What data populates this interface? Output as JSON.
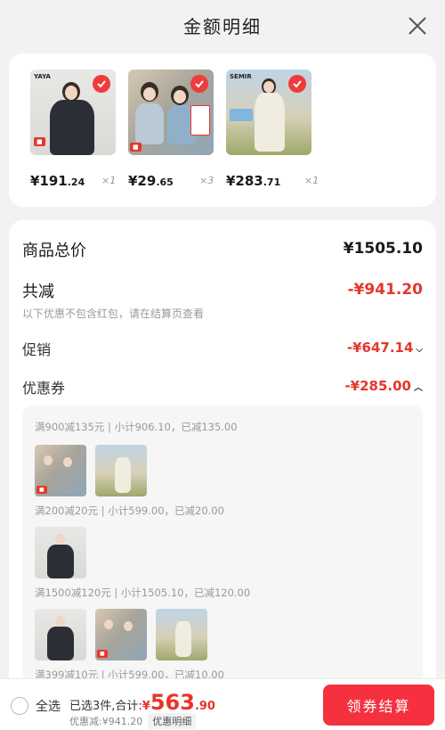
{
  "header": {
    "title": "金额明细"
  },
  "products": [
    {
      "brand": "YAYA",
      "price_int": "¥191",
      "price_dec": ".24",
      "qty": "×1"
    },
    {
      "price_int": "¥29",
      "price_dec": ".65",
      "qty": "×3"
    },
    {
      "brand": "SEMIR",
      "price_int": "¥283",
      "price_dec": ".71",
      "qty": "×1"
    }
  ],
  "summary": {
    "subtotal_label": "商品总价",
    "subtotal_value": "¥1505.10",
    "discount_label": "共减",
    "discount_value": "-¥941.20",
    "note": "以下优惠不包含红包，请在结算页查看",
    "promo_label": "促销",
    "promo_value": "-¥647.14",
    "coupon_label": "优惠券",
    "coupon_value": "-¥285.00"
  },
  "coupons": [
    {
      "text": "满900减135元 | 小计906.10，已减135.00"
    },
    {
      "text": "满200减20元 | 小计599.00，已减20.00"
    },
    {
      "text": "满1500减120元 | 小计1505.10，已减120.00"
    },
    {
      "text": "满399减10元 | 小计599.00，已减10.00"
    }
  ],
  "bottom": {
    "select_all": "全选",
    "selected_text": "已选3件,合计:",
    "total_currency": "¥",
    "total_int": "563",
    "total_dec": ".90",
    "discount_text": "优惠减:¥941.20",
    "detail_tag": "优惠明细",
    "checkout": "领券结算"
  },
  "colors": {
    "accent": "#e8352b",
    "checkout": "#f5303f"
  },
  "icons": {
    "close": "close-icon",
    "check": "check-icon",
    "chevron_down": "chevron-down-icon",
    "chevron_up": "chevron-up-icon"
  }
}
